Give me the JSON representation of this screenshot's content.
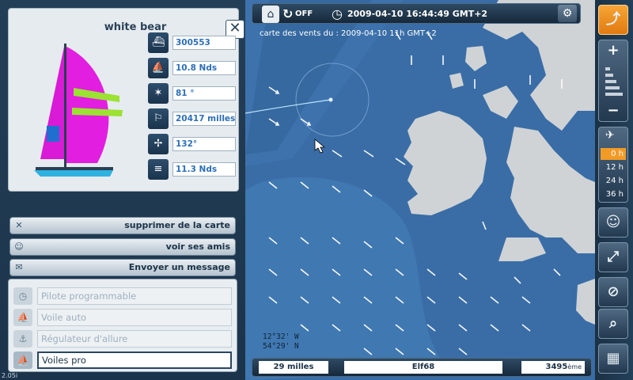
{
  "boat": {
    "name": "white bear",
    "stats": [
      {
        "icon": "boat-number-icon",
        "glyph": "⛴",
        "value": "300553"
      },
      {
        "icon": "sail-speed-icon",
        "glyph": "⛵",
        "value": "10.8 Nds"
      },
      {
        "icon": "compass-heading-icon",
        "glyph": "✶",
        "value": "81 °"
      },
      {
        "icon": "distance-icon",
        "glyph": "⚐",
        "value": "20417 milles"
      },
      {
        "icon": "wind-direction-icon",
        "glyph": "✢",
        "value": "132°"
      },
      {
        "icon": "wind-speed-icon",
        "glyph": "≡",
        "value": "11.3 Nds"
      }
    ]
  },
  "actions": {
    "remove_map": "supprimer de la carte",
    "see_friends": "voir ses amis",
    "send_message": "Envoyer un message"
  },
  "tools": [
    {
      "label": "Pilote programmable",
      "icon": "clock-autopilot-icon",
      "glyph": "◷",
      "active": false
    },
    {
      "label": "Voile auto",
      "icon": "auto-sail-icon",
      "glyph": "⛵",
      "active": false
    },
    {
      "label": "Régulateur d'allure",
      "icon": "wind-vane-icon",
      "glyph": "⚓",
      "active": false
    },
    {
      "label": "Voiles pro",
      "icon": "pro-sails-icon",
      "glyph": "⛵",
      "active": true
    }
  ],
  "version": "2.05i",
  "topbar": {
    "refresh_label": "OFF",
    "datetime": "2009-04-10 16:44:49 GMT+2"
  },
  "map": {
    "wind_caption": "carte des vents du : 2009-04-10 11h GMT+2",
    "lon": "12°32' W",
    "lat": "54°29' N"
  },
  "bottombar": {
    "distance": "29 milles",
    "player": "Elf68",
    "rank": "3495",
    "rank_suffix": "ème"
  },
  "timeline": {
    "options": [
      "0 h",
      "12 h",
      "24 h",
      "36 h"
    ],
    "selected": "0 h"
  },
  "colors": {
    "sea": "#3a6da6",
    "land": "#cfd3d6",
    "accent": "#f29a26",
    "value_text": "#2c6fb7"
  }
}
